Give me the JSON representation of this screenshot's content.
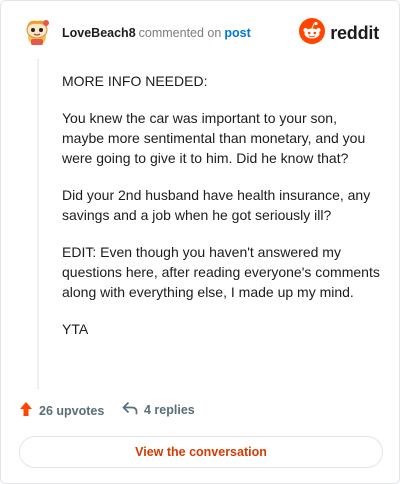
{
  "header": {
    "username": "LoveBeach8",
    "action_text": "commented on",
    "link_text": "post",
    "brand": "reddit",
    "avatar_icon": "snoo-avatar-icon",
    "brand_icon": "reddit-snoo-icon",
    "brand_color": "#ff4500"
  },
  "comment": {
    "paragraphs": [
      "MORE INFO NEEDED:",
      "You knew the car was important to your son, maybe more sentimental than monetary, and you were going to give it to him. Did he know that?",
      "Did your 2nd husband have health insurance, any savings and a job when he got seriously ill?",
      "EDIT: Even though you haven't answered my questions here, after reading everyone's comments along with everything else, I made up my mind.",
      "YTA"
    ]
  },
  "actions": {
    "upvotes": "26 upvotes",
    "replies": "4 replies",
    "upvote_icon": "upvote-arrow-icon",
    "reply_icon": "reply-arrow-icon"
  },
  "cta": {
    "label": "View the conversation",
    "color": "#d93a00"
  }
}
